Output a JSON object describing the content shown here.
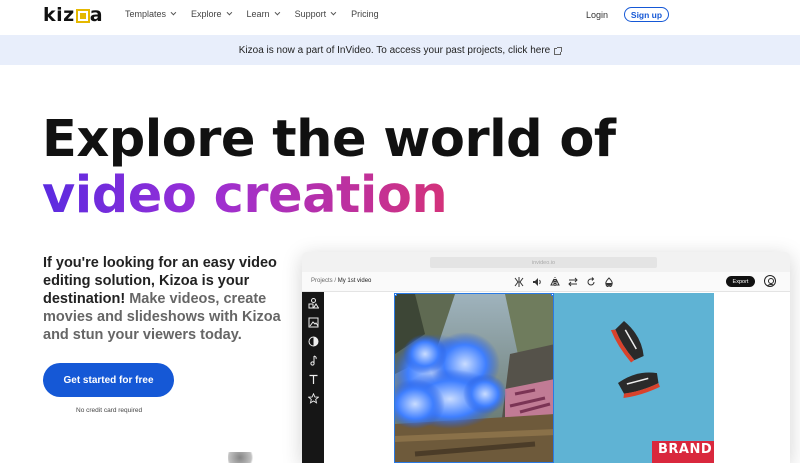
{
  "nav": {
    "logo": "kizoa",
    "menu": [
      "Templates",
      "Explore",
      "Learn",
      "Support",
      "Pricing"
    ],
    "login": "Login",
    "signup": "Sign up"
  },
  "banner": {
    "text": "Kizoa is now a part of InVideo. To access your past projects, click here"
  },
  "hero": {
    "title_line1": "Explore the world of",
    "title_line2": "video creation",
    "gradient_colors": [
      "#5b2be0",
      "#9b2fd6",
      "#d4327a"
    ],
    "lead_strong": "If you're looking for an easy video editing solution, Kizoa is your destination!",
    "lead_rest": " Make videos, create movies and slideshows with Kizoa and stun your viewers today.",
    "cta": "Get started for free",
    "cta_note": "No credit card required",
    "cta_color": "#1558d6"
  },
  "editor": {
    "url": "invideo.io",
    "crumb_root": "Projects",
    "crumb_sep": "/",
    "crumb_current": "My 1st video",
    "export": "Export",
    "side_icons": [
      "shapes-icon",
      "media-icon",
      "transitions-icon",
      "music-icon",
      "text-icon",
      "star-icon"
    ],
    "tool_icons": [
      "split-icon",
      "volume-icon",
      "flip-horizontal-icon",
      "swap-icon",
      "rotate-icon",
      "color-icon"
    ],
    "brand_text": "BRAND"
  }
}
